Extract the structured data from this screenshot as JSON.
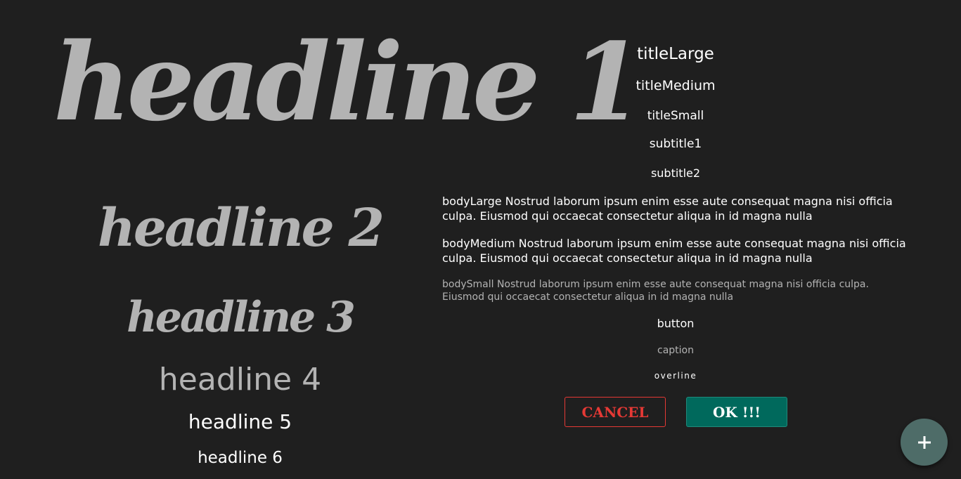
{
  "headlines": {
    "h1": "headline 1",
    "h2": "headline 2",
    "h3": "headline 3",
    "h4": "headline 4",
    "h5": "headline 5",
    "h6": "headline 6"
  },
  "styles": {
    "titleLarge": "titleLarge",
    "titleMedium": "titleMedium",
    "titleSmall": "titleSmall",
    "subtitle1": "subtitle1",
    "subtitle2": "subtitle2",
    "bodyLarge": " bodyLarge Nostrud laborum ipsum enim esse aute consequat magna nisi officia culpa. Eiusmod qui occaecat consectetur aliqua in id magna nulla",
    "bodyMedium": "bodyMedium Nostrud laborum ipsum enim esse aute consequat magna nisi officia culpa. Eiusmod qui occaecat consectetur aliqua in id magna nulla",
    "bodySmall": "bodySmall Nostrud laborum ipsum enim esse aute consequat magna nisi officia culpa. Eiusmod qui occaecat consectetur aliqua in id magna nulla",
    "button": "button",
    "caption": "caption",
    "overline": "overline"
  },
  "actions": {
    "cancel_label": "CANCEL",
    "ok_label": "OK !!!"
  },
  "fab": {
    "icon": "plus-icon"
  },
  "colors": {
    "background": "#1f1f1f",
    "headline_gray": "#b3b3b3",
    "cancel_red": "#e53935",
    "ok_teal": "#00695c",
    "fab": "#4e6c68"
  }
}
